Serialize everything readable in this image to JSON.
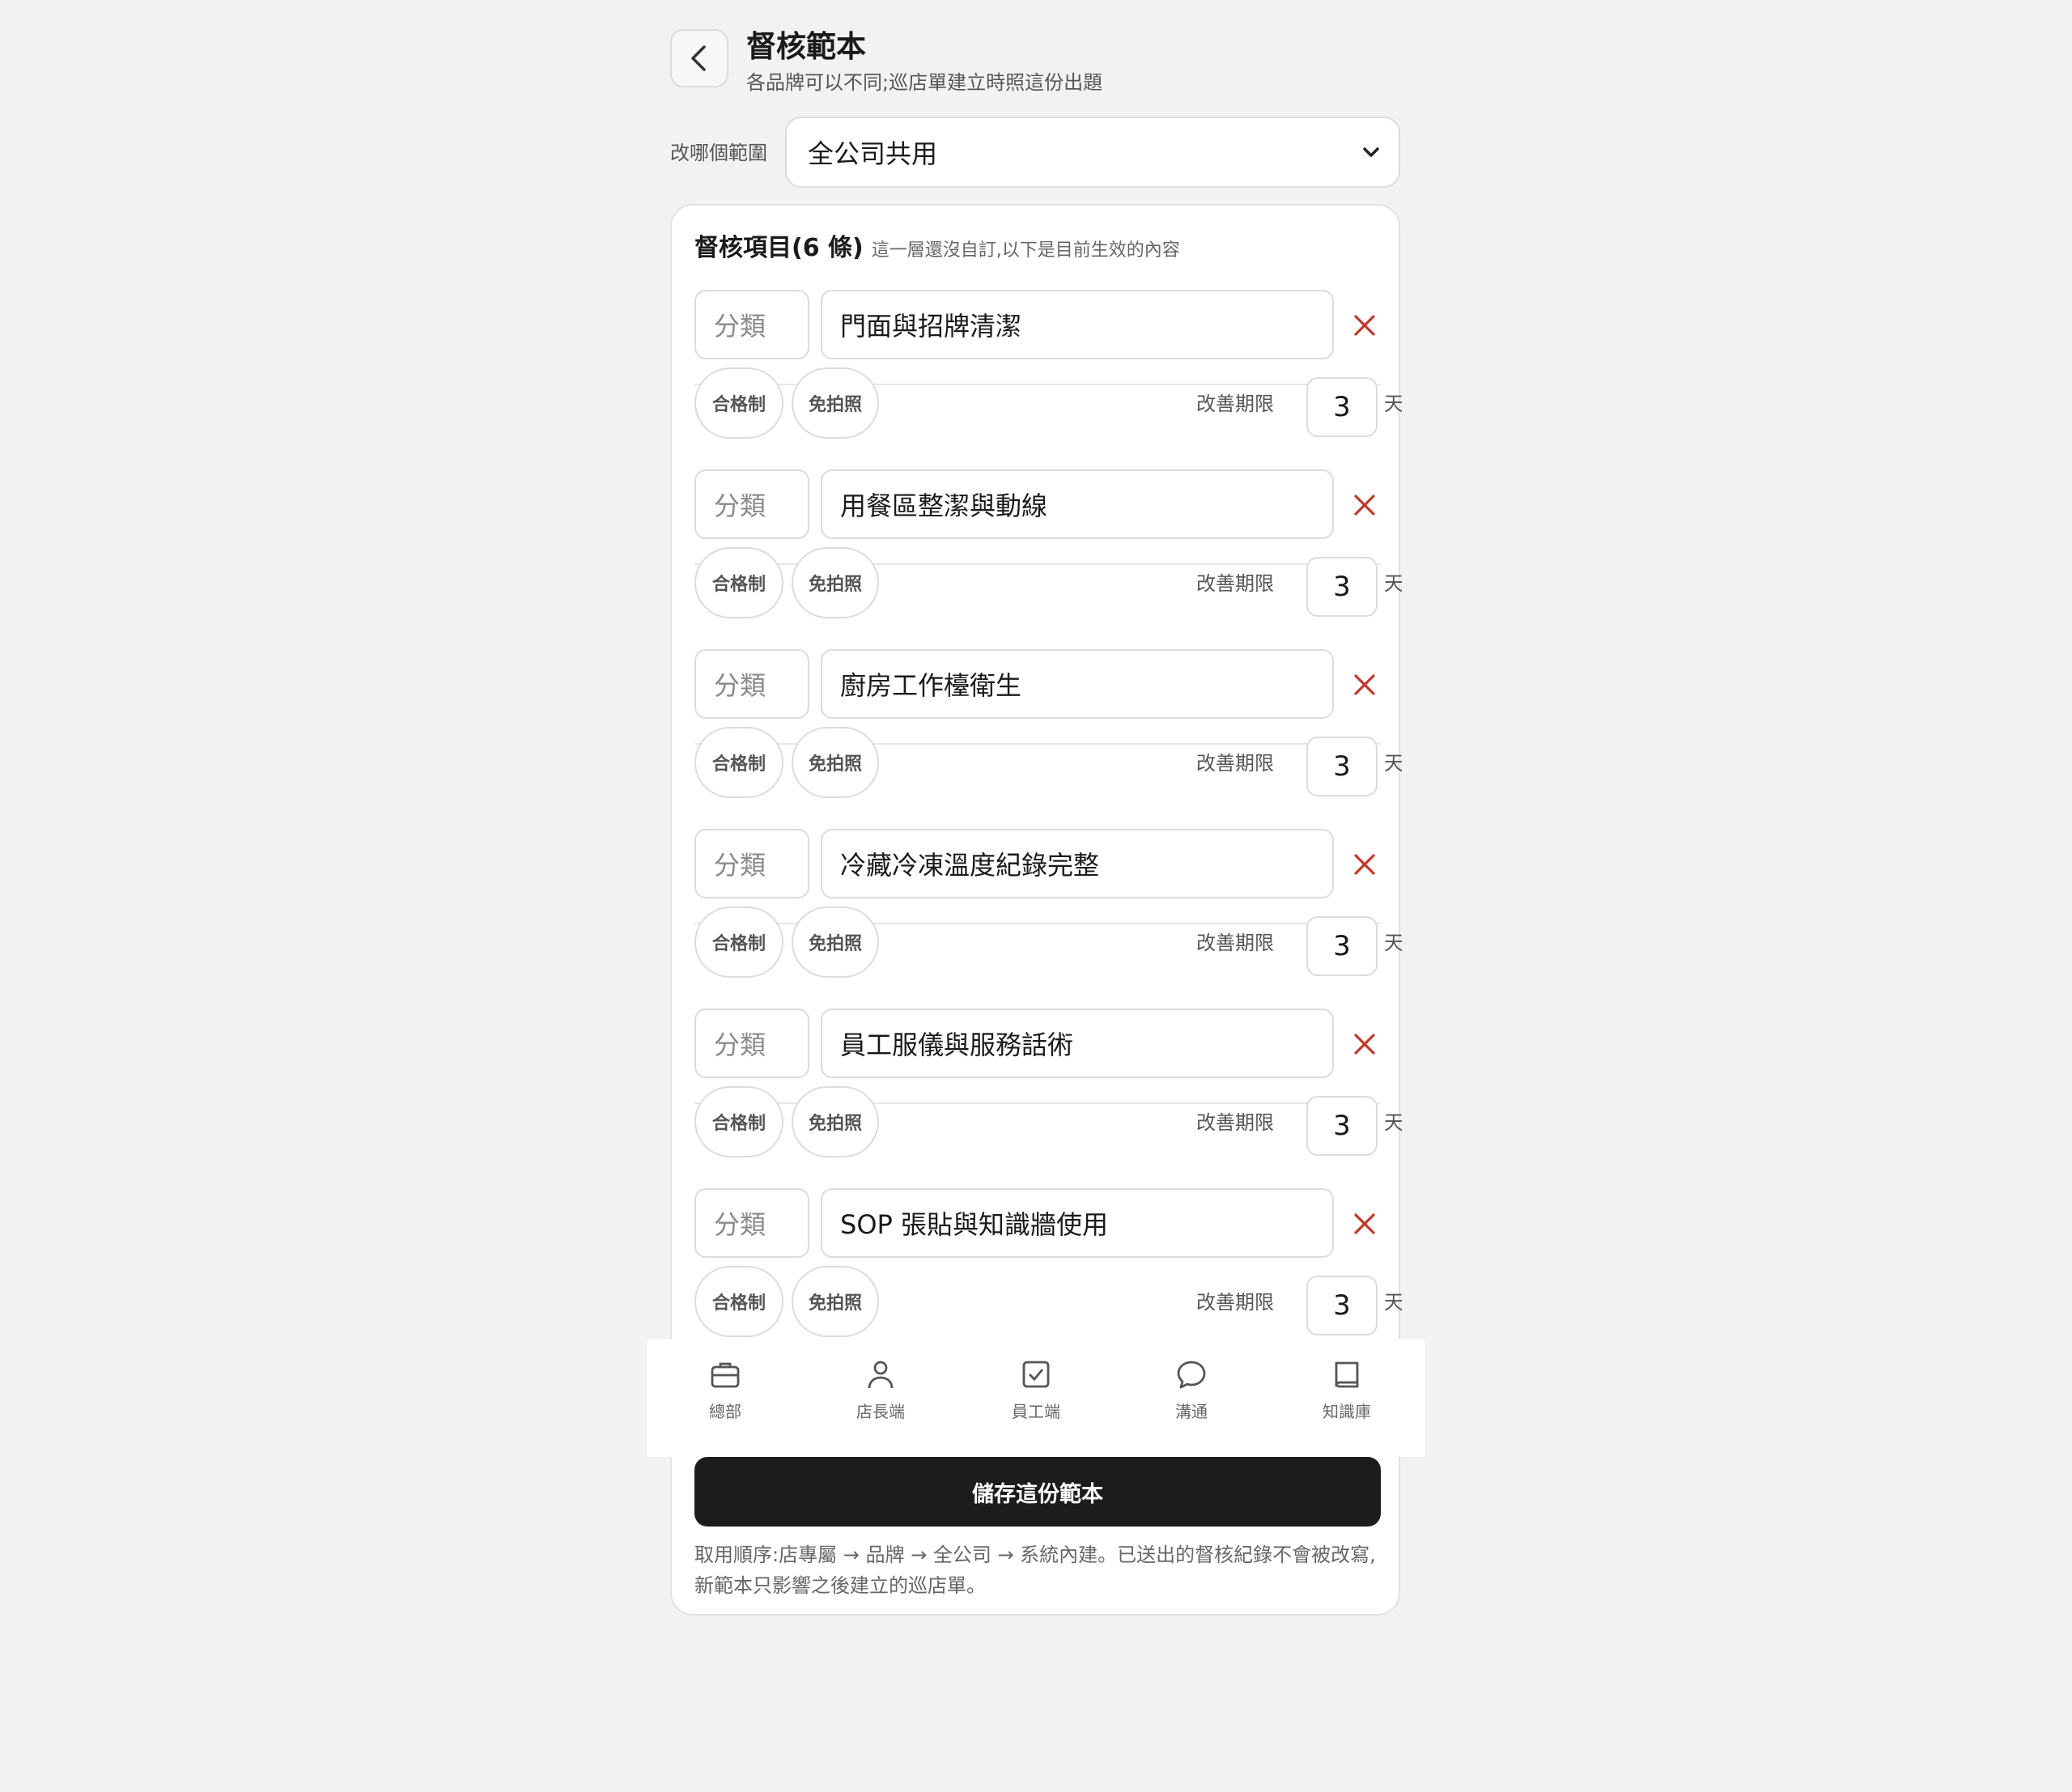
{
  "header": {
    "title": "督核範本",
    "subtitle": "各品牌可以不同;巡店單建立時照這份出題"
  },
  "scope": {
    "label": "改哪個範圍",
    "selected": "全公司共用"
  },
  "section": {
    "title": "督核項目(6 條)",
    "note": "這一層還沒自訂,以下是目前生效的內容"
  },
  "item_labels": {
    "category_placeholder": "分類",
    "pass_fail": "合格制",
    "no_photo": "免拍照",
    "deadline_label": "改善期限",
    "deadline_unit": "天"
  },
  "items": [
    {
      "title": "門面與招牌清潔",
      "deadline": "3"
    },
    {
      "title": "用餐區整潔與動線",
      "deadline": "3"
    },
    {
      "title": "廚房工作檯衛生",
      "deadline": "3"
    },
    {
      "title": "冷藏冷凍溫度紀錄完整",
      "deadline": "3"
    },
    {
      "title": "員工服儀與服務話術",
      "deadline": "3"
    },
    {
      "title": "SOP 張貼與知識牆使用",
      "deadline": "3"
    }
  ],
  "save_label": "儲存這份範本",
  "footnote": "取用順序:店專屬 → 品牌 → 全公司 → 系統內建。已送出的督核紀錄不會被改寫,新範本只影響之後建立的巡店單。",
  "nav": [
    {
      "label": "總部",
      "icon": "briefcase-icon"
    },
    {
      "label": "店長端",
      "icon": "person-icon"
    },
    {
      "label": "員工端",
      "icon": "checkbox-icon"
    },
    {
      "label": "溝通",
      "icon": "chat-bubble-icon"
    },
    {
      "label": "知識庫",
      "icon": "book-icon"
    }
  ],
  "colors": {
    "delete": "#c0392b",
    "save_button": "#1c1c1c",
    "background": "#f2f2f0"
  }
}
